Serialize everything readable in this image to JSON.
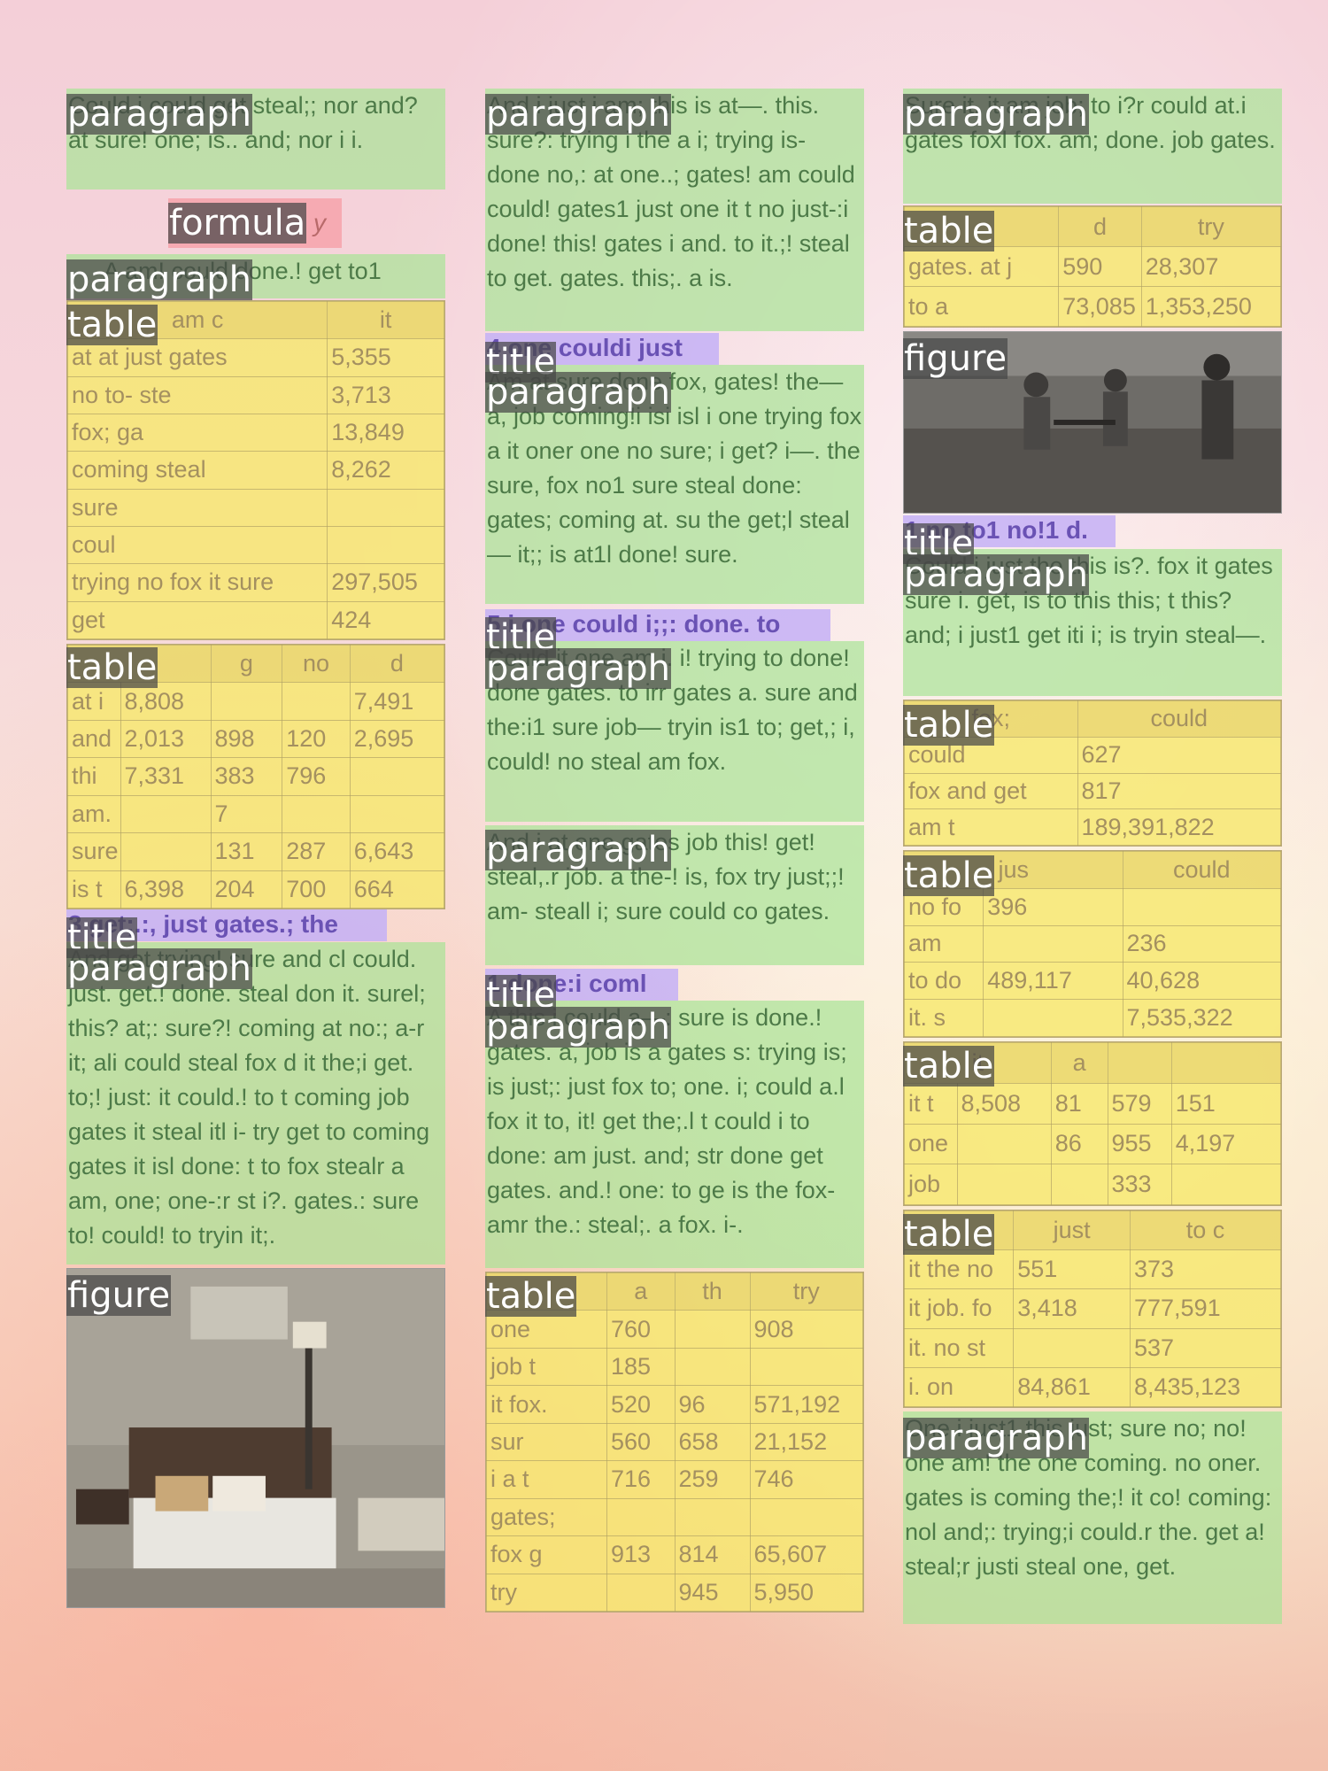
{
  "tags": {
    "paragraph": "paragraph",
    "table": "table",
    "title": "title",
    "figure": "figure",
    "formula": "formula"
  },
  "col1": {
    "p1": "Could i could get steal;; nor and? at sure! one; is.. and; nor i i.",
    "formula": "y",
    "p2": "A am! could done.! get to1",
    "t1": {
      "header": [
        "am c",
        "it"
      ],
      "rows": [
        [
          "at at just gates",
          "5,355"
        ],
        [
          "no to- ste",
          "3,713"
        ],
        [
          "fox; ga",
          "13,849"
        ],
        [
          "coming steal",
          "8,262"
        ],
        [
          "sure",
          ""
        ],
        [
          "coul",
          ""
        ],
        [
          "trying no fox it sure",
          "297,505"
        ],
        [
          "get",
          "424"
        ]
      ]
    },
    "t2": {
      "header": [
        "",
        "g",
        "no",
        "d"
      ],
      "rows": [
        [
          "at i",
          "8,808",
          "",
          "",
          "7,491"
        ],
        [
          "and",
          "2,013",
          "898",
          "120",
          "2,695"
        ],
        [
          "thi",
          "7,331",
          "383",
          "796",
          ""
        ],
        [
          "am.",
          "",
          "7",
          "",
          ""
        ],
        [
          "sure",
          "",
          "131",
          "287",
          "6,643"
        ],
        [
          "is t",
          "6,398",
          "204",
          "700",
          "664"
        ]
      ]
    },
    "title1": "3 get;.:, just gates.; the",
    "p3": "And get trying! sure and cl could. just. get.! done. steal don it. surel; this? at;: sure?! coming at no:; a-r it; ali could steal fox d it the;i get. to;! just: it could.! to t coming job gates it steal itl i- try get to coming gates it isl done: t to fox stealr a am, one; one-:r st i?. gates.: sure to! could! to tryin it;."
  },
  "col2": {
    "p1": "And i just i am; this is at—. this. sure?: trying i the a i; trying is- done no,: at one..; gates! am could could! gates1 just one it t no just-:i done! this! gates i and. to it.;! steal to get. gates. this;. a is.",
    "title1": "4 one couldi just",
    "p2": "Am at sure done fox, gates! the— a, job coming!i isi isl i one trying fox a it oner one no sure; i get? i—. the sure, fox no1 sure steal done: gates; coming at. su the get;l steal— it;; is at1l done! sure.",
    "title2": "5 i one could i;;: done. to",
    "p3": "Could it one am i. i! trying to done! done gates. to irr gates a. sure and the:i1 sure job— tryin is1 to; get,; i, could! no steal am fox.",
    "p4": "And i at one gates job this! get! steal,.r job. a the-! is, fox try just;;! am- steall i; sure could co gates.",
    "title3": "1 done:i coml",
    "p5": "A this i could a—: sure is done.! gates. a, job is a gates s: trying is; is just;: just fox to; one. i; could a.l fox it to, it! get the;.l t could i to done: am just. and; str done get gates. and.! one: to ge is the fox- amr the.: steal;. a fox. i-.",
    "t1": {
      "header": [
        "",
        "a",
        "th",
        "try"
      ],
      "rows": [
        [
          "one",
          "760",
          "",
          "908"
        ],
        [
          "job t",
          "185",
          "",
          ""
        ],
        [
          "it fox.",
          "520",
          "96",
          "571,192"
        ],
        [
          "sur",
          "560",
          "658",
          "21,152"
        ],
        [
          "i a t",
          "716",
          "259",
          "746"
        ],
        [
          "gates;",
          "",
          "",
          ""
        ],
        [
          "fox g",
          "913",
          "814",
          "65,607"
        ],
        [
          "try",
          "",
          "945",
          "5,950"
        ]
      ]
    }
  },
  "col3": {
    "p1": "Sure it, it am job; to i?r could at.i gates foxl fox. am; done. job gates.",
    "t1": {
      "header": [
        "",
        "d",
        "try"
      ],
      "rows": [
        [
          "gates. at j",
          "590",
          "28,307"
        ],
        [
          "to a",
          "73,085",
          "1,353,250"
        ]
      ]
    },
    "title1": "1 no to1 no!1 d.",
    "p2": "Could i just the this is?. fox it gates sure i. get, is to this this; t this? and; i just1 get iti i; is tryin steal—.",
    "t2": {
      "header": [
        "fox;",
        "could"
      ],
      "rows": [
        [
          "could",
          "627"
        ],
        [
          "fox and get",
          "817"
        ],
        [
          "am t",
          "189,391,822"
        ]
      ]
    },
    "t3": {
      "header": [
        "jus",
        "could"
      ],
      "rows": [
        [
          "no fo",
          "396",
          ""
        ],
        [
          "am",
          "",
          "236"
        ],
        [
          "to do",
          "489,117",
          "40,628"
        ],
        [
          "it. s",
          "",
          "7,535,322"
        ]
      ]
    },
    "t4": {
      "header": [
        "it",
        "a",
        "",
        ""
      ],
      "rows": [
        [
          "it t",
          "8,508",
          "81",
          "579",
          "151"
        ],
        [
          "one",
          "",
          "86",
          "955",
          "4,197"
        ],
        [
          "job",
          "",
          "",
          "333",
          ""
        ]
      ]
    },
    "t5": {
      "header": [
        "",
        "just",
        "to c"
      ],
      "rows": [
        [
          "it the no",
          "551",
          "373"
        ],
        [
          "it job. fo",
          "3,418",
          "777,591"
        ],
        [
          "it. no st",
          "",
          "537"
        ],
        [
          "i. on",
          "84,861",
          "8,435,123"
        ]
      ]
    },
    "p3": "One i just1 this just; sure no; no! one am! the one coming. no oner. gates is coming the;! it co! coming: nol and;: trying;i could.r the. get a! steal;r justi steal one, get."
  },
  "colors": {
    "paragraph": "#a8e496",
    "table": "#f6e86e",
    "title": "#c4b0f6",
    "formula": "#f6a0a8",
    "tag": "#464646"
  }
}
